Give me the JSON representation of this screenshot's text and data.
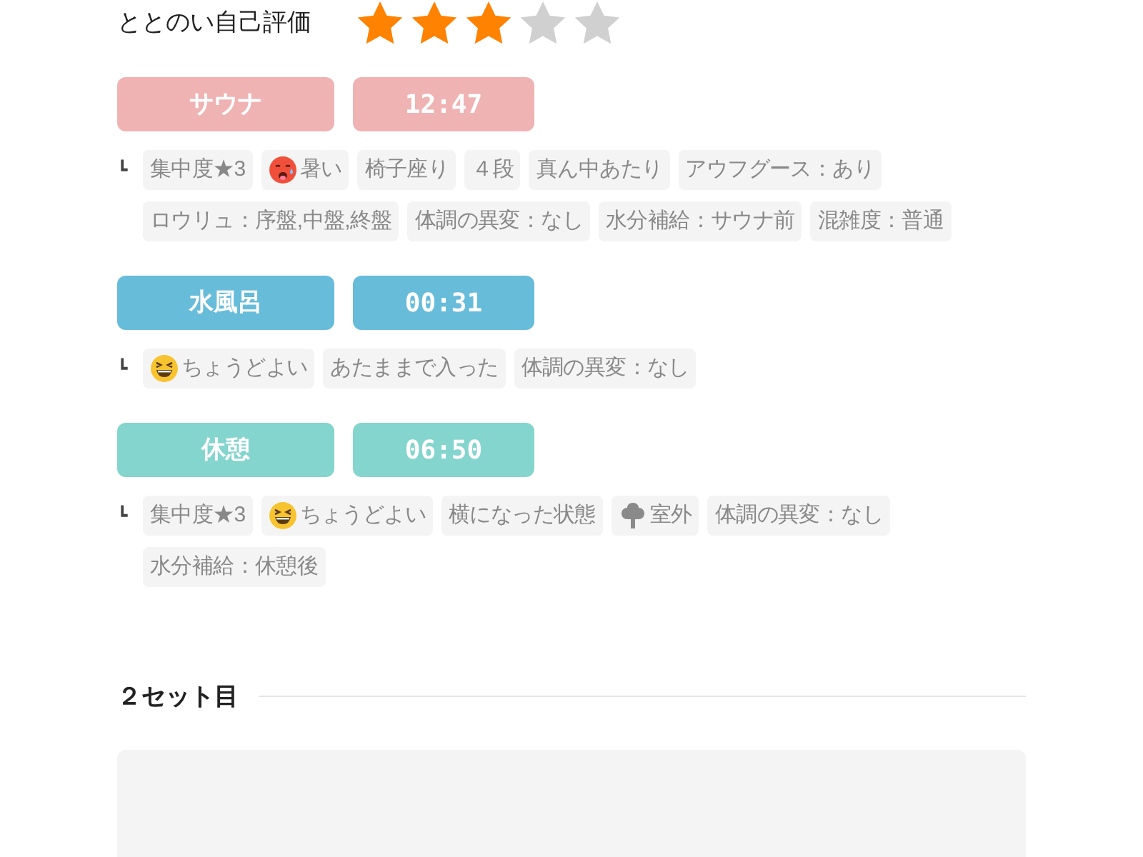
{
  "rating": {
    "label": "ととのい自己評価",
    "stars": 3
  },
  "steps": [
    {
      "kind": "sauna",
      "name": "サウナ",
      "time": "12:47",
      "branch": "┗",
      "tags": [
        {
          "kind": "plain",
          "text": "集中度★3"
        },
        {
          "kind": "hot",
          "text": "暑い"
        },
        {
          "kind": "plain",
          "text": "椅子座り"
        },
        {
          "kind": "plain",
          "text": "４段"
        },
        {
          "kind": "plain",
          "text": "真ん中あたり"
        },
        {
          "kind": "plain",
          "text": "アウフグース：あり"
        },
        {
          "kind": "plain",
          "text": "ロウリュ：序盤,中盤,終盤"
        },
        {
          "kind": "plain",
          "text": "体調の異変：なし"
        },
        {
          "kind": "plain",
          "text": "水分補給：サウナ前"
        },
        {
          "kind": "plain",
          "text": "混雑度：普通"
        }
      ]
    },
    {
      "kind": "water",
      "name": "水風呂",
      "time": "00:31",
      "branch": "┗",
      "tags": [
        {
          "kind": "pleasant",
          "text": "ちょうどよい"
        },
        {
          "kind": "plain",
          "text": "あたままで入った"
        },
        {
          "kind": "plain",
          "text": "体調の異変：なし"
        }
      ]
    },
    {
      "kind": "rest",
      "name": "休憩",
      "time": "06:50",
      "branch": "┗",
      "tags": [
        {
          "kind": "plain",
          "text": "集中度★3"
        },
        {
          "kind": "pleasant",
          "text": "ちょうどよい"
        },
        {
          "kind": "plain",
          "text": "横になった状態"
        },
        {
          "kind": "outdoor",
          "text": "室外"
        },
        {
          "kind": "plain",
          "text": "体調の異変：なし"
        },
        {
          "kind": "plain",
          "text": "水分補給：休憩後"
        }
      ]
    }
  ],
  "next_set": {
    "title": "２セット目"
  }
}
